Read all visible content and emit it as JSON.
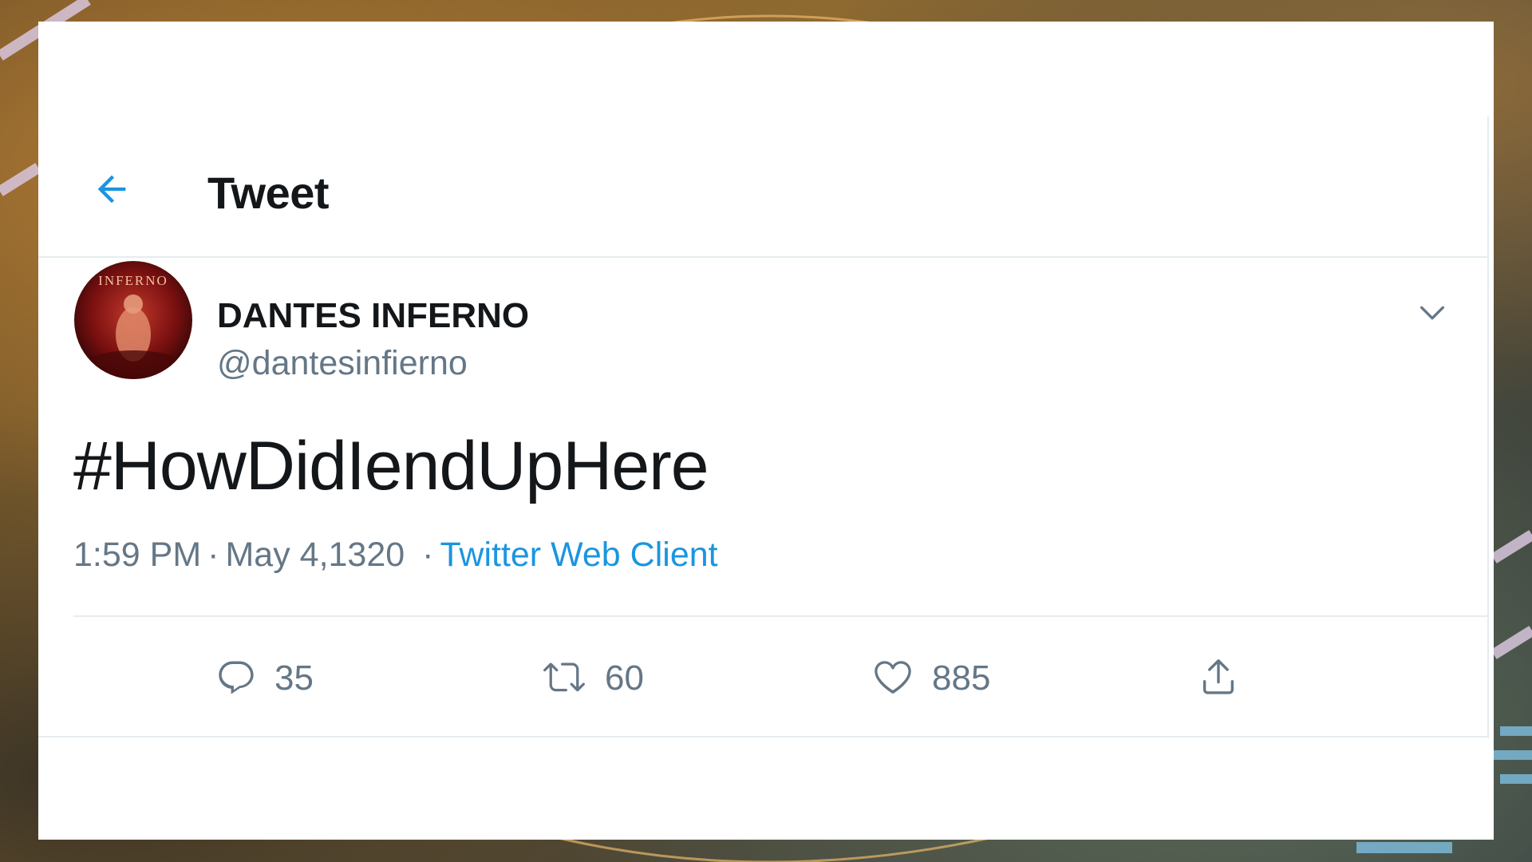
{
  "header": {
    "back_icon": "arrow-left-icon",
    "title": "Tweet"
  },
  "tweet": {
    "author": {
      "display_name": "DANTES INFERNO",
      "handle": "@dantesinfierno",
      "avatar_text": "INFERNO"
    },
    "menu_icon": "chevron-down-icon",
    "text": "#HowDidIendUpHere",
    "meta": {
      "time": "1:59 PM",
      "separator": "·",
      "date": "May 4,1320",
      "client": "Twitter Web Client"
    },
    "actions": {
      "reply": {
        "icon": "reply-icon",
        "count": "35"
      },
      "retweet": {
        "icon": "retweet-icon",
        "count": "60"
      },
      "like": {
        "icon": "heart-icon",
        "count": "885"
      },
      "share": {
        "icon": "share-icon"
      }
    }
  },
  "colors": {
    "accent": "#1b95e0",
    "text_primary": "#14171a",
    "text_secondary": "#657786",
    "divider": "#e6ecf0"
  }
}
